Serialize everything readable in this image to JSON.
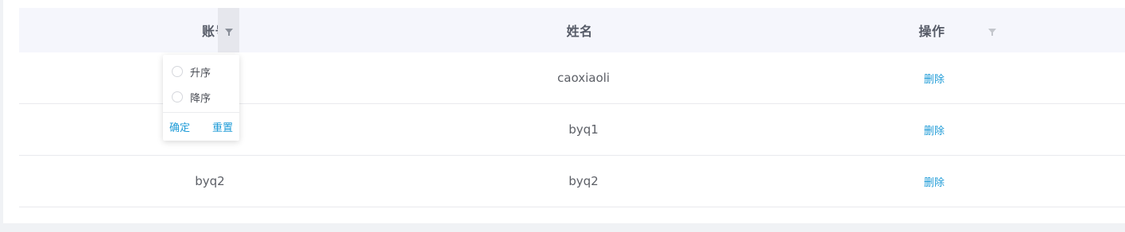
{
  "table": {
    "columns": [
      {
        "label": "账号",
        "filter_active": true
      },
      {
        "label": "姓名",
        "filter_active": false
      },
      {
        "label": "操作",
        "filter_active": false
      }
    ],
    "rows": [
      {
        "account": "",
        "name": "caoxiaoli",
        "action": "删除"
      },
      {
        "account": "",
        "name": "byq1",
        "action": "删除"
      },
      {
        "account": "byq2",
        "name": "byq2",
        "action": "删除"
      }
    ]
  },
  "filter_dropdown": {
    "options": [
      "升序",
      "降序"
    ],
    "confirm_label": "确定",
    "reset_label": "重置"
  },
  "colors": {
    "header_bg": "#f5f6fc",
    "link": "#1e9bd7",
    "page_bg": "#f0f2f5"
  },
  "icons": {
    "filter": "funnel-icon"
  }
}
